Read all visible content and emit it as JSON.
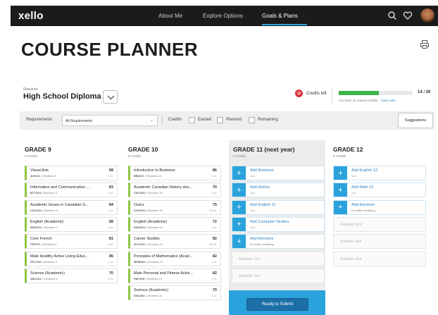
{
  "nav": {
    "logo": "xello",
    "links": [
      {
        "label": "About Me",
        "active": false
      },
      {
        "label": "Explore Options",
        "active": false
      },
      {
        "label": "Goals & Plans",
        "active": true
      }
    ],
    "icons": [
      "search-icon",
      "heart-icon",
      "avatar"
    ]
  },
  "page": {
    "title": "COURSE PLANNER"
  },
  "diploma": {
    "required_label": "Required",
    "name": "High School Diploma",
    "credits_left_count": "12",
    "credits_left_label": "Credits left",
    "progress_fraction": 0.54,
    "progress_text": "14 / 26",
    "unused_note": "You have 11 unused credits.",
    "learn_why": "Learn why"
  },
  "filters": {
    "requirements_label": "Requirements",
    "requirements_value": "All Requirements",
    "credits_label": "Credits",
    "options": [
      "Earned",
      "Planned",
      "Remaining"
    ],
    "suggestions_button": "Suggestions"
  },
  "grades": [
    {
      "title": "GRADE 9",
      "credits": "8 Credits",
      "courses": [
        {
          "name": "Visual Arts",
          "code": "AVI1O1",
          "type": "Electives 9",
          "grade": "68",
          "credit": "1 cr."
        },
        {
          "name": "Information and Communication ...",
          "code": "BTT1O1",
          "type": "Electives 9",
          "grade": "83",
          "credit": "1 cr."
        },
        {
          "name": "Academic Issues in Canadian G...",
          "code": "CGC1D1",
          "type": "Electives 9",
          "grade": "84",
          "credit": "1 cr."
        },
        {
          "name": "English (Academic)",
          "code": "ENG1D1",
          "type": "Electives 9",
          "grade": "68",
          "credit": "1 cr."
        },
        {
          "name": "Core French",
          "code": "FSF1P1",
          "type": "Electives 9",
          "grade": "81",
          "credit": "1 cr."
        },
        {
          "name": "Male Healthy Active Living Educ...",
          "code": "PPL1O9",
          "type": "Electives 9",
          "grade": "85",
          "credit": "1 cr."
        },
        {
          "name": "Science (Academic)",
          "code": "SNC1D1",
          "type": "Electives 9",
          "grade": "70",
          "credit": "1 cr."
        }
      ]
    },
    {
      "title": "GRADE 10",
      "credits": "8 Credits",
      "courses": [
        {
          "name": "Introduction to Business",
          "code": "BBI2O1",
          "type": "Electives 10",
          "grade": "86",
          "credit": "1 cr."
        },
        {
          "name": "Academic Canadian History sinc...",
          "code": "CHC2D1",
          "type": "Electives 10",
          "grade": "70",
          "credit": "1 cr."
        },
        {
          "name": "Civics",
          "code": "CHV2O1",
          "type": "Electives 10",
          "grade": "75",
          "credit": "0.5 cr."
        },
        {
          "name": "English (Academic)",
          "code": "ENG2D1",
          "type": "Electives 10",
          "grade": "72",
          "credit": "1 cr."
        },
        {
          "name": "Career Studies",
          "code": "GLC2O1",
          "type": "Electives 10",
          "grade": "82",
          "credit": "0.5 cr."
        },
        {
          "name": "Principles of Mathematics (Acad...",
          "code": "MPM2D1",
          "type": "Electives 10",
          "grade": "82",
          "credit": "1 cr."
        },
        {
          "name": "Male Personal and Fitness Activi...",
          "code": "PAF2O9",
          "type": "Electives 10",
          "grade": "82",
          "credit": "1 cr."
        },
        {
          "name": "Science (Academic)",
          "code": "SNC2D1",
          "type": "Electives 10",
          "grade": "70",
          "credit": "1 cr."
        }
      ]
    },
    {
      "title": "GRADE 11 (next year)",
      "credits": "0 Credits",
      "adds": [
        {
          "name": "Add Business",
          "sub": "1 cr."
        },
        {
          "name": "Add History",
          "sub": "1 cr."
        },
        {
          "name": "Add English 11",
          "sub": "1 cr."
        },
        {
          "name": "Add Computer Studies",
          "sub": "1 cr."
        },
        {
          "name": "Add Electives",
          "sub": "8 credits remaining"
        }
      ],
      "available": [
        "Available Slot",
        "Available Slot"
      ],
      "submit": "Ready to Submit"
    },
    {
      "title": "GRADE 12",
      "credits": "0 Credits",
      "adds": [
        {
          "name": "Add English 12",
          "sub": "1 cr."
        },
        {
          "name": "Add Math 12",
          "sub": "1 cr."
        },
        {
          "name": "Add Electives",
          "sub": "8 credits remaining"
        }
      ],
      "available": [
        "Available Slot",
        "Available Slot",
        "Available Slot"
      ]
    }
  ],
  "colors": {
    "accent": "#2aa3dc",
    "completed": "#8dc63f",
    "progress": "#3cb54a",
    "alert": "#d9323c"
  }
}
